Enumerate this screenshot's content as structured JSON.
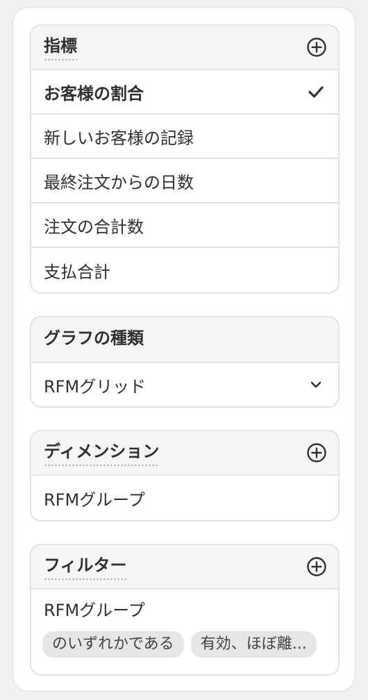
{
  "metrics": {
    "title": "指標",
    "add_icon": "circle-plus-icon",
    "items": [
      {
        "label": "お客様の割合",
        "selected": true
      },
      {
        "label": "新しいお客様の記録",
        "selected": false
      },
      {
        "label": "最終注文からの日数",
        "selected": false
      },
      {
        "label": "注文の合計数",
        "selected": false
      },
      {
        "label": "支払合計",
        "selected": false
      }
    ],
    "selected_icon": "checkmark-icon"
  },
  "chart_type": {
    "title": "グラフの種類",
    "value": "RFMグリッド",
    "dropdown_icon": "chevron-down-icon"
  },
  "dimensions": {
    "title": "ディメンション",
    "add_icon": "circle-plus-icon",
    "items": [
      {
        "label": "RFMグループ"
      }
    ]
  },
  "filters": {
    "title": "フィルター",
    "add_icon": "circle-plus-icon",
    "items": [
      {
        "label": "RFMグループ",
        "operator": "のいずれかである",
        "value": "有効、ほぼ離..."
      }
    ]
  }
}
